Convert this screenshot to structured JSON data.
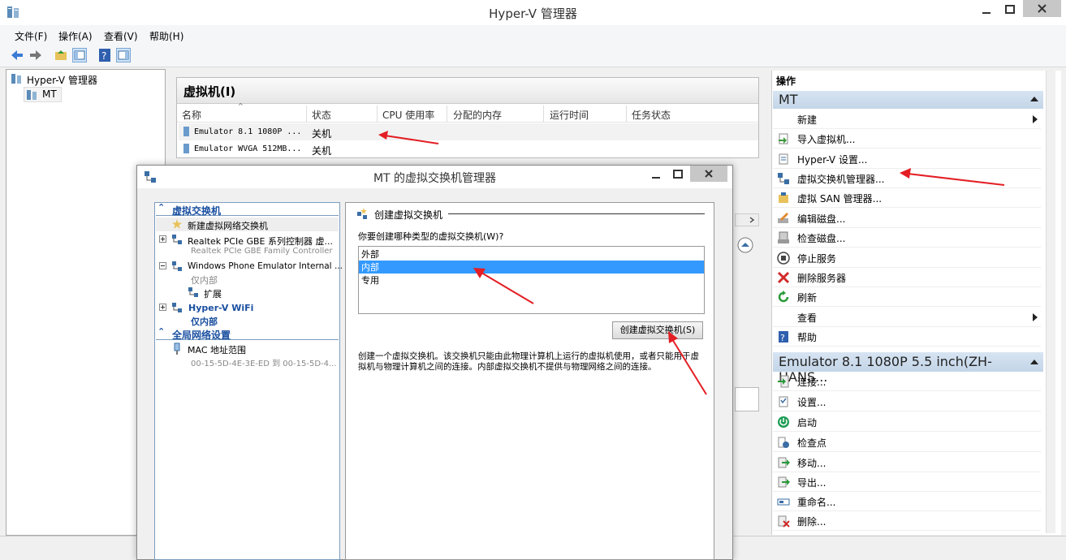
{
  "window": {
    "title": "Hyper-V 管理器"
  },
  "menu": [
    "文件(F)",
    "操作(A)",
    "查看(V)",
    "帮助(H)"
  ],
  "tree": {
    "root": "Hyper-V 管理器",
    "child": "MT"
  },
  "vm_panel": {
    "title": "虚拟机(I)",
    "columns": [
      "名称",
      "状态",
      "CPU 使用率",
      "分配的内存",
      "运行时间",
      "任务状态"
    ],
    "rows": [
      {
        "name": "Emulator 8.1 1080P ...",
        "status": "关机"
      },
      {
        "name": "Emulator WVGA 512MB...",
        "status": "关机"
      }
    ]
  },
  "actions": {
    "header": "操作",
    "section1": "MT",
    "items1": [
      "新建",
      "导入虚拟机...",
      "Hyper-V 设置...",
      "虚拟交换机管理器...",
      "虚拟 SAN 管理器...",
      "编辑磁盘...",
      "检查磁盘...",
      "停止服务",
      "删除服务器",
      "刷新",
      "查看",
      "帮助"
    ],
    "section2": "Emulator 8.1 1080P 5.5 inch(ZH-HANS...",
    "items2": [
      "连接...",
      "设置...",
      "启动",
      "检查点",
      "移动...",
      "导出...",
      "重命名...",
      "删除..."
    ]
  },
  "dialog": {
    "title": "MT 的虚拟交换机管理器",
    "left": {
      "section_switches": "虚拟交换机",
      "new_switch": "新建虚拟网络交换机",
      "realtek_name": "Realtek PCIe GBE 系列控制器 虚...",
      "realtek_sub": "Realtek PCIe GBE Family Controller",
      "wp_name": "Windows Phone Emulator Internal ...",
      "wp_sub": "仅内部",
      "extension": "扩展",
      "wifi_name": "Hyper-V WiFi",
      "wifi_sub": "仅内部",
      "section_global": "全局网络设置",
      "mac_label": "MAC 地址范围",
      "mac_range": "00-15-5D-4E-3E-ED 到 00-15-5D-4..."
    },
    "right": {
      "heading": "创建虚拟交换机",
      "question": "你要创建哪种类型的虚拟交换机(W)?",
      "types": [
        "外部",
        "内部",
        "专用"
      ],
      "selected": "内部",
      "create_button": "创建虚拟交换机(S)",
      "description": "创建一个虚拟交换机。该交换机只能由此物理计算机上运行的虚拟机使用，或者只能用于虚拟机与物理计算机之间的连接。内部虚拟交换机不提供与物理网络之间的连接。"
    }
  },
  "colors": {
    "accent": "#3399ff",
    "section_head": "#c3d5e8",
    "tree_blue": "#1a4fa0",
    "annotation_arrow": "#e31e24"
  }
}
